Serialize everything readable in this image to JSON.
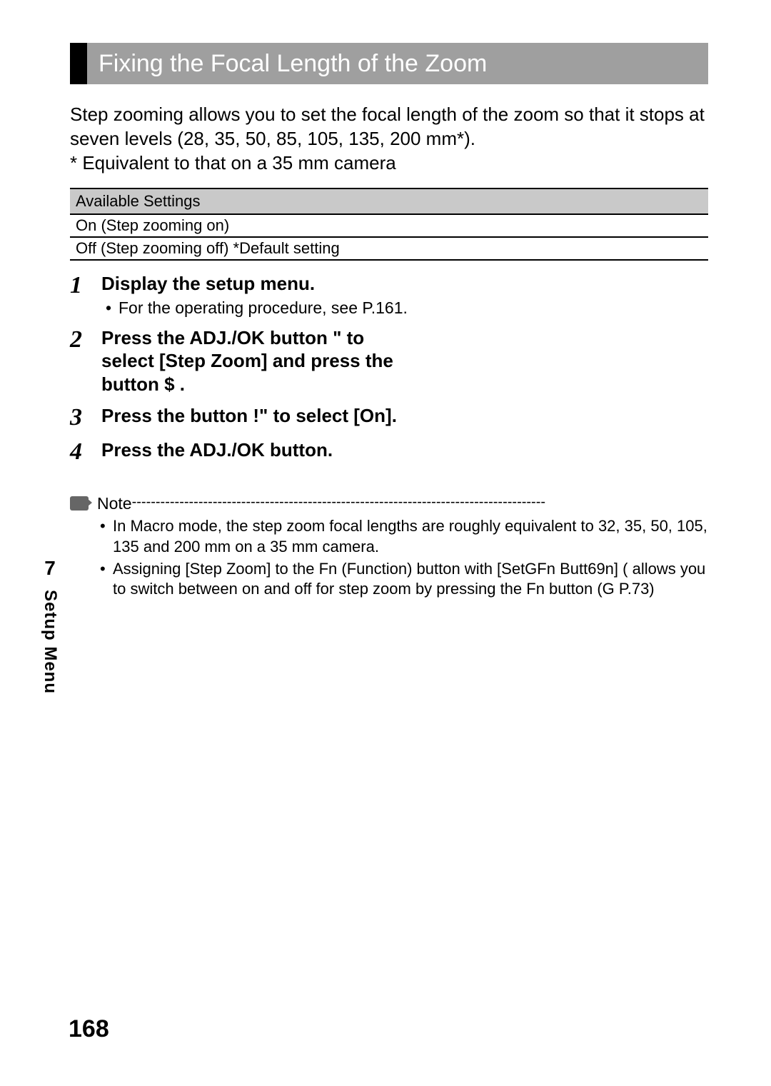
{
  "title": "Fixing the Focal Length of the Zoom",
  "intro": {
    "line1": "Step zooming allows you to set the focal length of the zoom so that it stops at seven levels (28, 35, 50, 85, 105, 135, 200 mm*).",
    "line2": "*  Equivalent to that on a 35 mm camera"
  },
  "settings": {
    "header": "Available Settings",
    "rows": [
      "On (Step zooming on)",
      "Off (Step zooming off) *Default setting"
    ]
  },
  "steps": [
    {
      "num": "1",
      "title": "Display the setup menu.",
      "sub": "For the operating procedure, see P.161."
    },
    {
      "num": "2",
      "title": "Press the ADJ./OK button \"   to select [Step Zoom] and press the button $ ."
    },
    {
      "num": "3",
      "title": "Press the button !\"     to select [On]."
    },
    {
      "num": "4",
      "title": "Press the ADJ./OK button."
    }
  ],
  "note": {
    "label": "Note",
    "dashes": "---------------------------------------------------------------------------------------",
    "items": [
      "In Macro mode, the step zoom focal lengths are roughly equivalent to 32, 35, 50, 105, 135 and 200 mm on a 35 mm camera.",
      "Assigning [Step Zoom] to the Fn (Function) button with [SetGFn  Butt69n] (  allows you to switch between on and off for step zoom by pressing the Fn button (G   P.73)"
    ]
  },
  "side": {
    "chapter": "7",
    "section": "Setup Menu"
  },
  "page_number": "168"
}
